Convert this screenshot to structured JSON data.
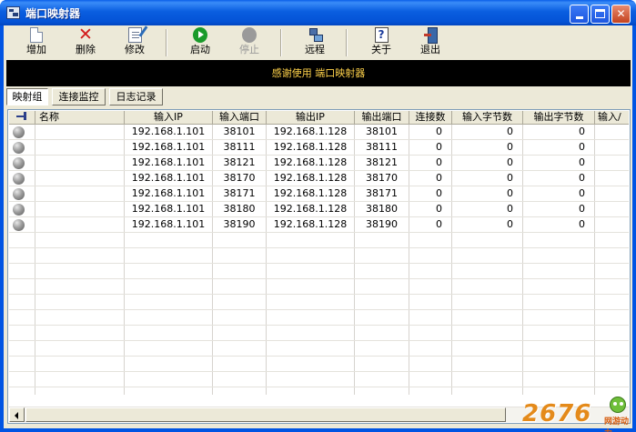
{
  "window": {
    "title": "端口映射器"
  },
  "toolbar": {
    "add": "增加",
    "delete": "删除",
    "edit": "修改",
    "start": "启动",
    "stop": "停止",
    "remote": "远程",
    "about": "关于",
    "exit": "退出"
  },
  "banner": {
    "text": "感谢使用 端口映射器"
  },
  "tabs": [
    "映射组",
    "连接监控",
    "日志记录"
  ],
  "table": {
    "columns": [
      "名称",
      "输入IP",
      "输入端口",
      "输出IP",
      "输出端口",
      "连接数",
      "输入字节数",
      "输出字节数",
      "输入/"
    ],
    "rows": [
      {
        "name": "",
        "in_ip": "192.168.1.101",
        "in_port": "38101",
        "out_ip": "192.168.1.128",
        "out_port": "38101",
        "conns": "0",
        "in_bytes": "0",
        "out_bytes": "0"
      },
      {
        "name": "",
        "in_ip": "192.168.1.101",
        "in_port": "38111",
        "out_ip": "192.168.1.128",
        "out_port": "38111",
        "conns": "0",
        "in_bytes": "0",
        "out_bytes": "0"
      },
      {
        "name": "",
        "in_ip": "192.168.1.101",
        "in_port": "38121",
        "out_ip": "192.168.1.128",
        "out_port": "38121",
        "conns": "0",
        "in_bytes": "0",
        "out_bytes": "0"
      },
      {
        "name": "",
        "in_ip": "192.168.1.101",
        "in_port": "38170",
        "out_ip": "192.168.1.128",
        "out_port": "38170",
        "conns": "0",
        "in_bytes": "0",
        "out_bytes": "0"
      },
      {
        "name": "",
        "in_ip": "192.168.1.101",
        "in_port": "38171",
        "out_ip": "192.168.1.128",
        "out_port": "38171",
        "conns": "0",
        "in_bytes": "0",
        "out_bytes": "0"
      },
      {
        "name": "",
        "in_ip": "192.168.1.101",
        "in_port": "38180",
        "out_ip": "192.168.1.128",
        "out_port": "38180",
        "conns": "0",
        "in_bytes": "0",
        "out_bytes": "0"
      },
      {
        "name": "",
        "in_ip": "192.168.1.101",
        "in_port": "38190",
        "out_ip": "192.168.1.128",
        "out_port": "38190",
        "conns": "0",
        "in_bytes": "0",
        "out_bytes": "0"
      }
    ]
  },
  "watermark": {
    "number": "2676",
    "site": "网游动力"
  },
  "colors": {
    "title_bar": "#0054e3",
    "banner_bg": "#000000",
    "banner_text": "#ffd24a",
    "status_ball": "#8a8a8a"
  }
}
